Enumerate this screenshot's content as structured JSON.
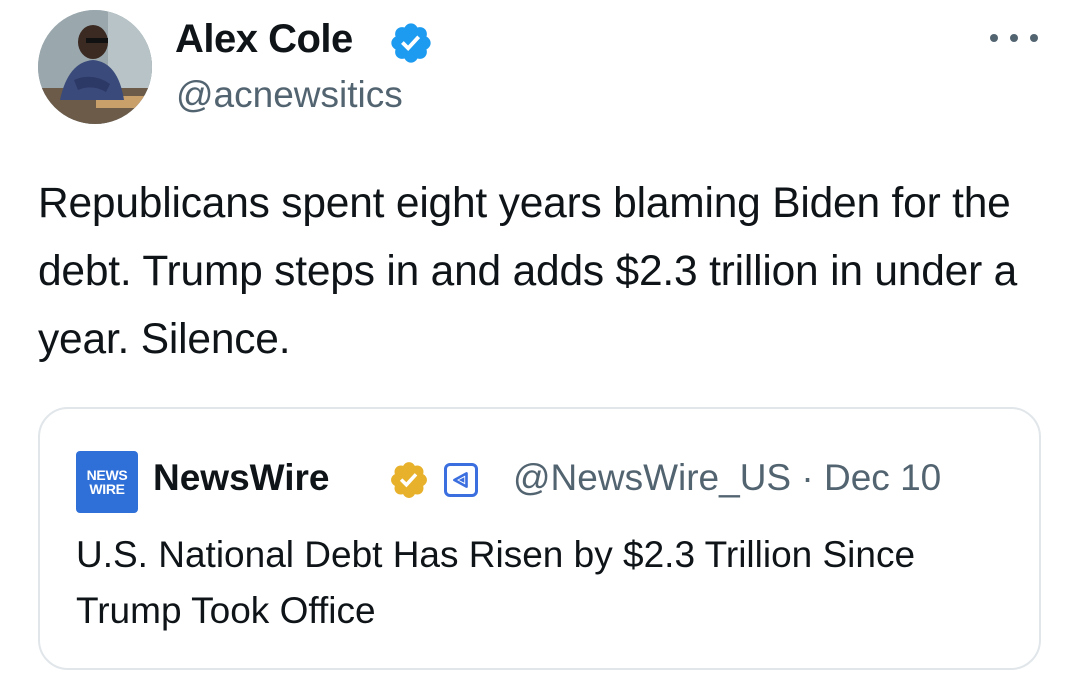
{
  "tweet": {
    "author": {
      "display_name": "Alex Cole",
      "handle": "@acnewsitics",
      "verified_color": "#1d9bf0"
    },
    "text": "Republicans spent eight years blaming Biden for the debt. Trump steps in and adds $2.3 trillion in under a year. Silence.",
    "more_icon": "more-horizontal-icon"
  },
  "quoted": {
    "logo_line1": "NEWS",
    "logo_line2": "WIRE",
    "display_name": "NewsWire",
    "verified_color": "#e8b12b",
    "handle": "@NewsWire_US",
    "separator": "·",
    "date": "Dec 10",
    "text": "U.S. National Debt Has Risen by $2.3 Trillion Since Trump Took Office"
  }
}
